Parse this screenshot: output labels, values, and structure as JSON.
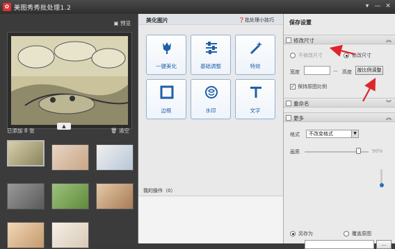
{
  "window": {
    "title": "美图秀秀批处理1.2",
    "icon": "meitu-logo-icon"
  },
  "left": {
    "preview_label": "预览",
    "added_label": "已添加 8 张",
    "clear_label": "清空",
    "thumbnails": [
      "thumb-1",
      "thumb-2",
      "thumb-3",
      "thumb-4",
      "thumb-5",
      "thumb-6",
      "thumb-7",
      "thumb-8"
    ]
  },
  "middle": {
    "title": "美化图片",
    "help": "批处理小技巧",
    "tools": [
      {
        "label": "一键美化",
        "icon": "tulip-icon"
      },
      {
        "label": "基础调整",
        "icon": "sliders-icon"
      },
      {
        "label": "特效",
        "icon": "magic-wand-icon"
      },
      {
        "label": "边框",
        "icon": "frame-icon"
      },
      {
        "label": "水印",
        "icon": "watermark-icon"
      },
      {
        "label": "文字",
        "icon": "text-t-icon"
      }
    ],
    "ops_label": "我的操作（0）"
  },
  "right": {
    "title": "保存设置",
    "resize_section": "修改尺寸",
    "no_resize": "不修改尺寸",
    "resize": "修改尺寸",
    "width_label": "宽度",
    "height_label": "高度",
    "ratio_button": "按比例调整",
    "keep_ratio": "保持原图比例",
    "rename_section": "重命名",
    "more_section": "更多",
    "format_label": "格式",
    "format_value": "不改变格式",
    "quality_label": "画质",
    "quality_value": "90%",
    "save_as": "另存为",
    "overwrite": "覆盖原图"
  },
  "colors": {
    "accent": "#1f5fa8",
    "arrow": "#e0242c"
  }
}
